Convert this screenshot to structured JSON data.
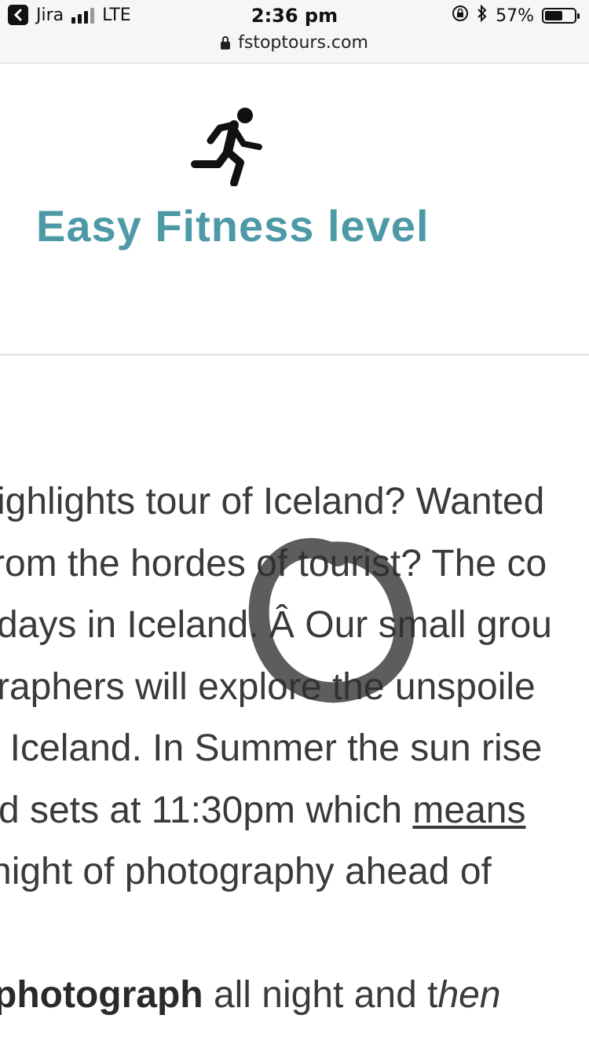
{
  "status_bar": {
    "back_app": "Jira",
    "network": "LTE",
    "time": "2:36 pm",
    "battery": "57%",
    "battery_level": 0.57,
    "url": "fstoptours.com"
  },
  "hero": {
    "icon": "running-person-icon",
    "title": "Easy Fitness level"
  },
  "body": {
    "lines": [
      "ighlights tour of Iceland? Wanted",
      "rom the hordes of tourist? The co",
      "days in Iceland. Â Our small grou",
      "raphers will explore the unspoile",
      "f Iceland. In Summer the sun rise",
      "d sets at 11:30pm which ",
      " night of photography ahead of"
    ],
    "link_text": "means",
    "para2_bold": "photograph",
    "para2_mid": " all night and t",
    "para2_ital": "hen"
  },
  "annotation": "hand-drawn-circle-highlight"
}
